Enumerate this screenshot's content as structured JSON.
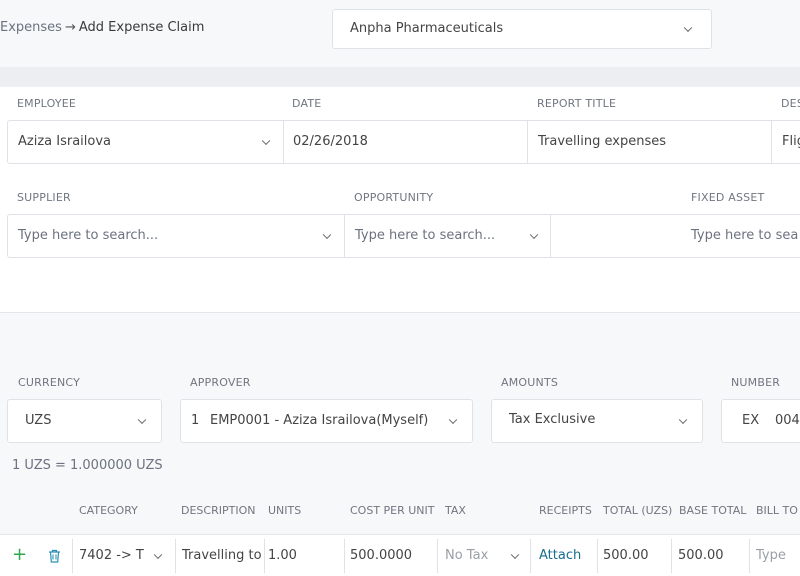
{
  "breadcrumb": {
    "root": "Expenses",
    "arrow": "→",
    "current": "Add Expense Claim"
  },
  "company": {
    "value": "Anpha Pharmaceuticals"
  },
  "header_fields": {
    "employee": {
      "label": "EMPLOYEE",
      "value": "Aziza Israilova"
    },
    "date": {
      "label": "DATE",
      "value": "02/26/2018"
    },
    "report_title": {
      "label": "REPORT TITLE",
      "value": "Travelling expenses"
    },
    "description": {
      "label": "DES",
      "value": "Flig"
    }
  },
  "link_fields": {
    "supplier": {
      "label": "SUPPLIER",
      "placeholder": "Type here to search..."
    },
    "opportunity": {
      "label": "OPPORTUNITY",
      "placeholder": "Type here to search..."
    },
    "fixed_asset": {
      "label": "FIXED ASSET",
      "placeholder": "Type here to sea"
    }
  },
  "settings": {
    "currency": {
      "label": "CURRENCY",
      "value": "UZS"
    },
    "approver": {
      "label": "APPROVER",
      "number": "1",
      "value": "EMP0001 - Aziza Israilova(Myself)"
    },
    "amounts": {
      "label": "AMOUNTS",
      "value": "Tax Exclusive"
    },
    "number": {
      "label": "NUMBER",
      "prefix": "EX",
      "value": "004"
    }
  },
  "exchange_rate": "1 UZS = 1.000000 UZS",
  "table": {
    "headers": {
      "category": "CATEGORY",
      "description": "DESCRIPTION",
      "units": "UNITS",
      "cost_per_unit": "COST PER UNIT",
      "tax": "TAX",
      "receipts": "RECEIPTS",
      "total": "TOTAL (UZS)",
      "base_total": "BASE TOTAL",
      "bill_to": "BILL TO"
    },
    "row": {
      "add": "+",
      "category": "7402 -> T",
      "description": "Travelling to",
      "units": "1.00",
      "cost_per_unit": "500.0000",
      "tax": "No Tax",
      "receipts": "Attach",
      "total": "500.00",
      "base_total": "500.00",
      "bill_to": "Type"
    }
  }
}
